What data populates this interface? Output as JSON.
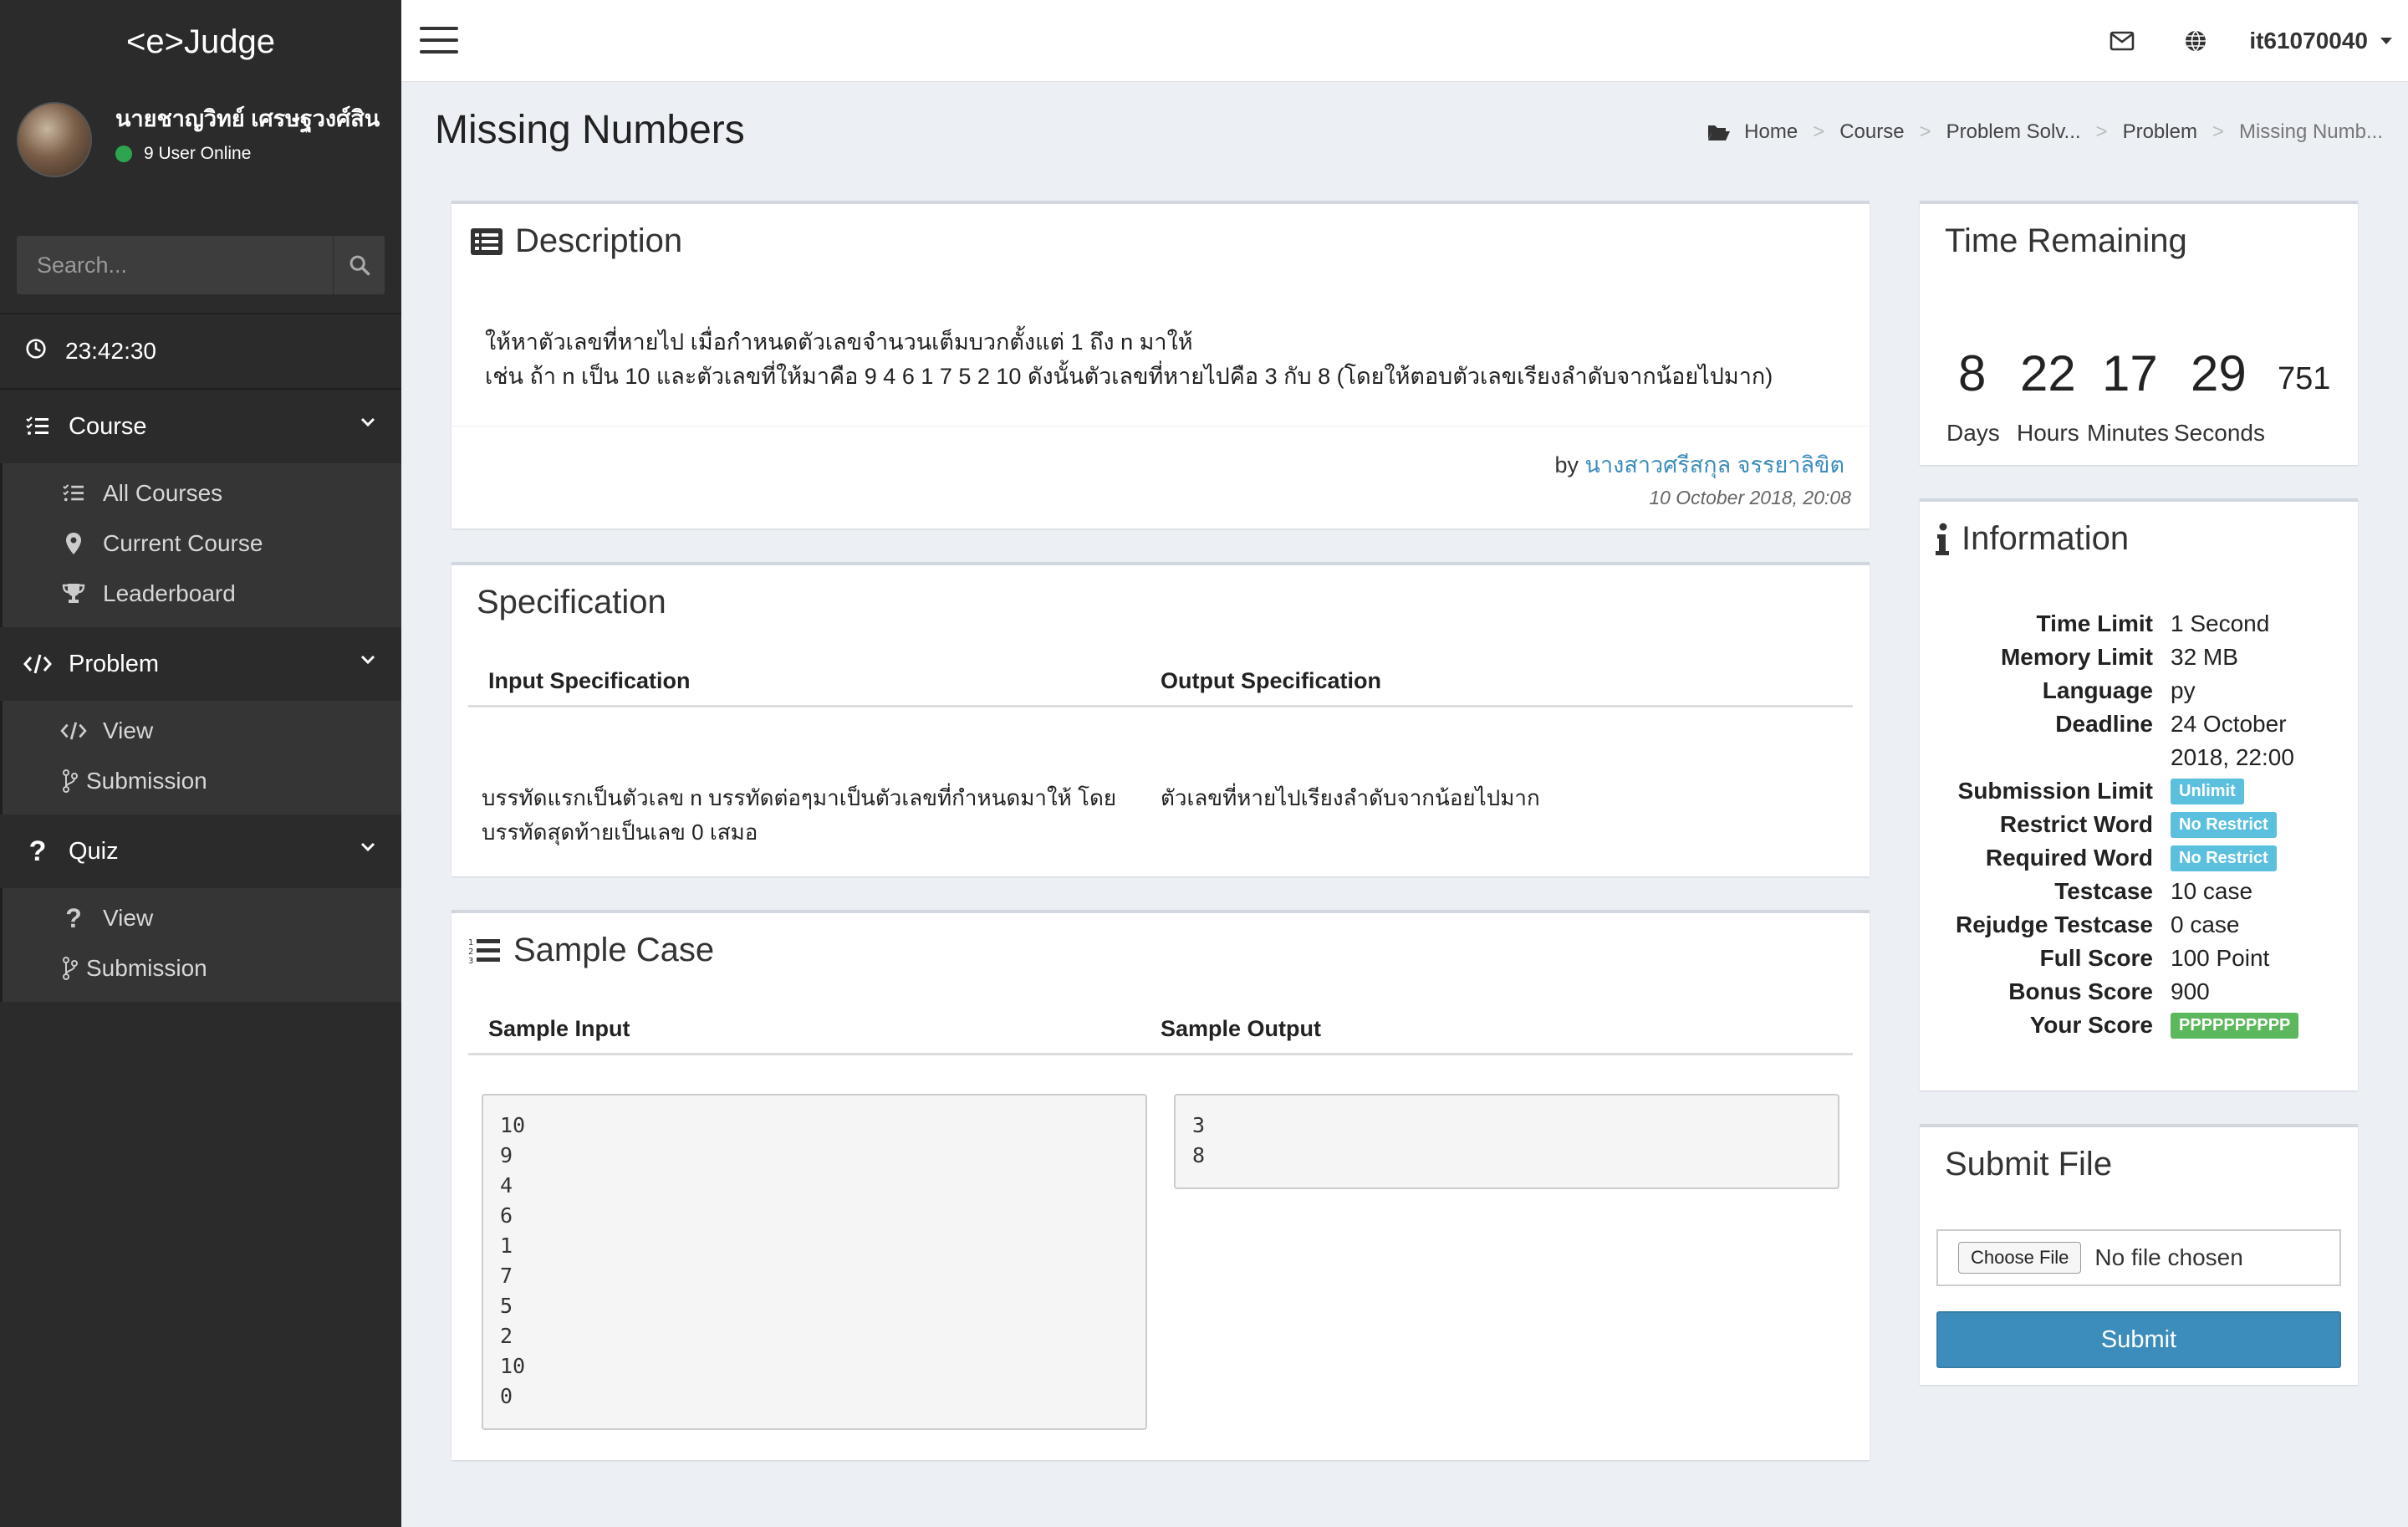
{
  "app": {
    "brand": "<e>Judge"
  },
  "user": {
    "name": "นายชาญวิทย์ เศรษฐวงศ์สิน",
    "online": "9 User Online",
    "username": "it61070040"
  },
  "search": {
    "placeholder": "Search..."
  },
  "clock": {
    "time": "23:42:30"
  },
  "sidebar": {
    "course": {
      "label": "Course",
      "items": [
        "All Courses",
        "Current Course",
        "Leaderboard"
      ]
    },
    "problem": {
      "label": "Problem",
      "items": [
        "View",
        "Submission"
      ]
    },
    "quiz": {
      "label": "Quiz",
      "items": [
        "View",
        "Submission"
      ]
    }
  },
  "page": {
    "title": "Missing Numbers"
  },
  "breadcrumb": [
    "Home",
    "Course",
    "Problem Solv...",
    "Problem",
    "Missing Numb..."
  ],
  "description": {
    "title": "Description",
    "line1": "ให้หาตัวเลขที่หายไป เมื่อกำหนดตัวเลขจำนวนเต็มบวกตั้งแต่ 1 ถึง n มาให้",
    "line2": "เช่น ถ้า n เป็น 10 และตัวเลขที่ให้มาคือ 9 4 6 1 7 5 2 10 ดังนั้นตัวเลขที่หายไปคือ 3 กับ 8 (โดยให้ตอบตัวเลขเรียงลำดับจากน้อยไปมาก)",
    "by_label": "by",
    "author": "นางสาวศรีสกุล จรรยาลิขิต",
    "date": "10 October 2018, 20:08"
  },
  "specification": {
    "title": "Specification",
    "input_header": "Input Specification",
    "output_header": "Output Specification",
    "input_text": "บรรทัดแรกเป็นตัวเลข n บรรทัดต่อๆมาเป็นตัวเลขที่กำหนดมาให้ โดยบรรทัดสุดท้ายเป็นเลข 0 เสมอ",
    "output_text": "ตัวเลขที่หายไปเรียงลำดับจากน้อยไปมาก"
  },
  "sample": {
    "title": "Sample Case",
    "input_header": "Sample Input",
    "output_header": "Sample Output",
    "input": "10\n9\n4\n6\n1\n7\n5\n2\n10\n0",
    "output": "3\n8"
  },
  "timer": {
    "title": "Time Remaining",
    "days": "8",
    "hours": "22",
    "minutes": "17",
    "seconds": "29",
    "ms": "751",
    "days_label": "Days",
    "hours_label": "Hours",
    "minutes_label": "Minutes",
    "seconds_label": "Seconds"
  },
  "info": {
    "title": "Information",
    "rows": [
      {
        "key": "Time Limit",
        "value": "1 Second"
      },
      {
        "key": "Memory Limit",
        "value": "32 MB"
      },
      {
        "key": "Language",
        "value": "py"
      },
      {
        "key": "Deadline",
        "value": "24 October"
      },
      {
        "key": "",
        "value": "2018, 22:00"
      },
      {
        "key": "Submission Limit",
        "badge": "Unlimit",
        "color": "#5bc0de"
      },
      {
        "key": "Restrict Word",
        "badge": "No Restrict",
        "color": "#5bc0de"
      },
      {
        "key": "Required Word",
        "badge": "No Restrict",
        "color": "#5bc0de"
      },
      {
        "key": "Testcase",
        "value": "10 case"
      },
      {
        "key": "Rejudge Testcase",
        "value": "0 case"
      },
      {
        "key": "Full Score",
        "value": "100 Point"
      },
      {
        "key": "Bonus Score",
        "value": "900"
      },
      {
        "key": "Your Score",
        "badge": "PPPPPPPPPP",
        "color": "#5cb85c"
      }
    ]
  },
  "submit": {
    "title": "Submit File",
    "choose_label": "Choose File",
    "no_file": "No file chosen",
    "button": "Submit"
  },
  "colors": {
    "sidebar": "#2b2b2b",
    "accent": "#3c8dbc",
    "info_badge": "#5bc0de",
    "success_badge": "#5cb85c",
    "online_dot": "#2ea44f"
  }
}
